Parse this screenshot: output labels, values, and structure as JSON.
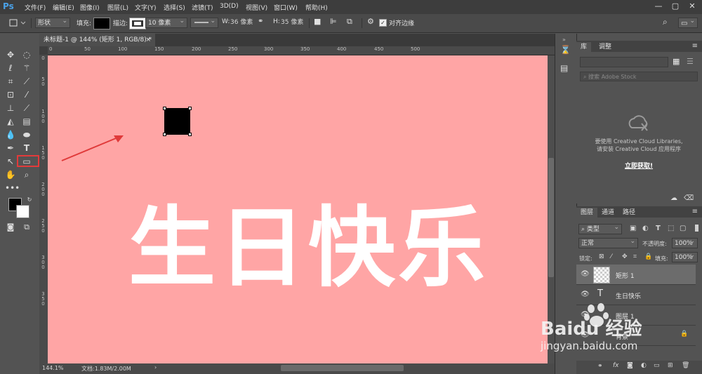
{
  "app": {
    "logo": "Ps"
  },
  "menu": [
    "文件(F)",
    "编辑(E)",
    "图像(I)",
    "图层(L)",
    "文字(Y)",
    "选择(S)",
    "滤镜(T)",
    "3D(D)",
    "视图(V)",
    "窗口(W)",
    "帮助(H)"
  ],
  "window_controls": {
    "minimize": "—",
    "restore": "▢",
    "close": "✕"
  },
  "options": {
    "mode": "形状",
    "fill_label": "填充:",
    "stroke_label": "描边:",
    "stroke_size": "10 像素",
    "w_label": "W:",
    "w_value": "36 像素",
    "h_label": "H:",
    "h_value": "35 像素",
    "align_edges": "对齐边缘"
  },
  "document": {
    "tab_title": "未标题-1 @ 144% (矩形 1, RGB/8) *"
  },
  "ruler": {
    "h": [
      "0",
      "50",
      "100",
      "150",
      "200",
      "250",
      "300",
      "350",
      "400",
      "450",
      "500"
    ],
    "v": [
      "0",
      "5\n0",
      "1\n0\n0",
      "1\n5\n0",
      "2\n0\n0",
      "2\n5\n0",
      "3\n0\n0",
      "3\n5\n0"
    ]
  },
  "canvas": {
    "text": "生日快乐",
    "bg": "#ffa5a5"
  },
  "status": {
    "zoom": "144.1%",
    "doc": "文档:1.83M/2.00M"
  },
  "library": {
    "tab_lib": "库",
    "tab_adjust": "调整",
    "search_placeholder": "搜索 Adobe Stock",
    "message_line1": "要使用 Creative Cloud Libraries,",
    "message_line2": "请安装 Creative Cloud 应用程序",
    "link": "立即获取!"
  },
  "layers": {
    "tab_layers": "图层",
    "tab_channels": "通道",
    "tab_paths": "路径",
    "filter": "类型",
    "blend": "正常",
    "opacity_label": "不透明度:",
    "opacity_value": "100%",
    "lock_label": "锁定:",
    "fill_label": "填充:",
    "fill_value": "100%",
    "items": [
      {
        "name": "矩形 1"
      },
      {
        "name": "生日快乐"
      },
      {
        "name": "图层 1"
      },
      {
        "name": "背景"
      }
    ]
  },
  "watermark": {
    "brand": "Baidu 经验",
    "url": "jingyan.baidu.com"
  }
}
